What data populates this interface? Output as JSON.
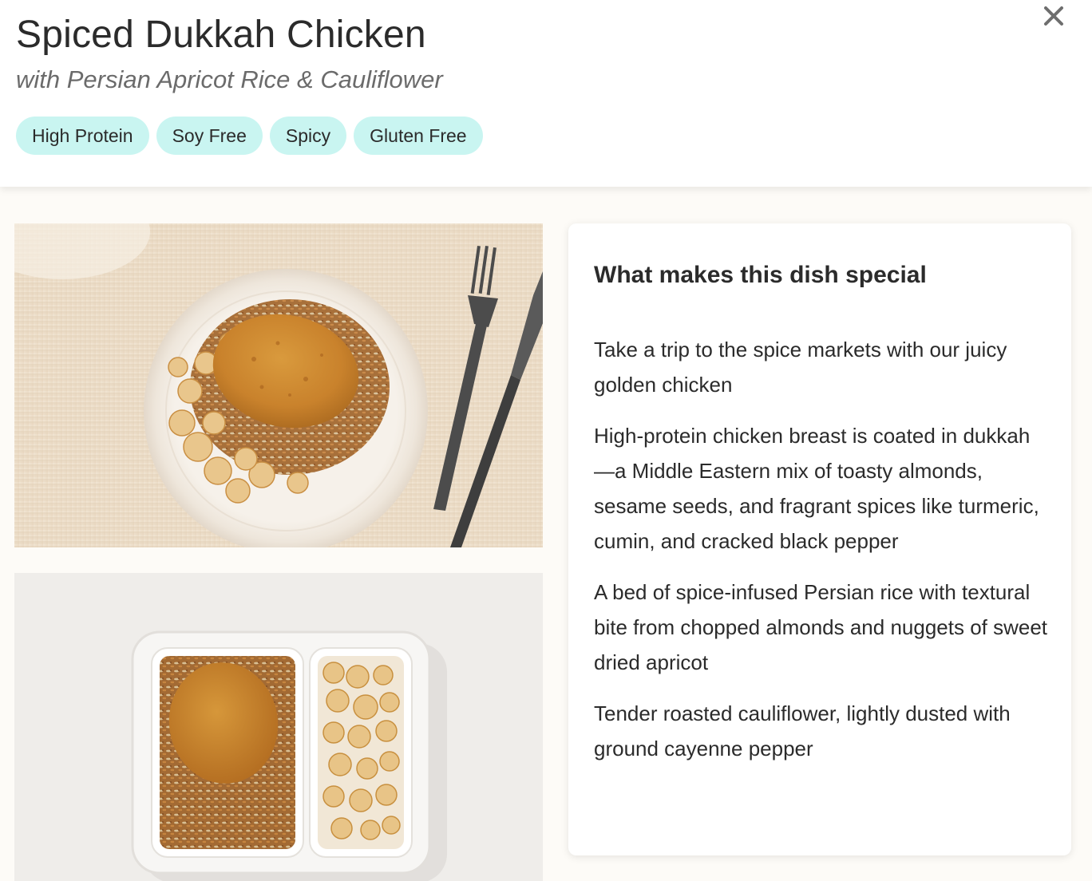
{
  "header": {
    "title": "Spiced Dukkah Chicken",
    "subtitle": "with Persian Apricot Rice & Cauliflower",
    "tags": [
      "High Protein",
      "Soy Free",
      "Spicy",
      "Gluten Free"
    ],
    "close_icon": "close-icon"
  },
  "images": {
    "plated_photo": "plated-dish-photo",
    "container_photo": "meal-container-photo"
  },
  "special": {
    "title": "What makes this dish special",
    "points": [
      "Take a trip to the spice markets with our juicy golden chicken",
      "High-protein chicken breast is coated in dukkah—a Middle Eastern mix of toasty almonds, sesame seeds, and fragrant spices like turmeric, cumin, and cracked black pepper",
      "A bed of spice-infused Persian rice with textural bite from chopped almonds and nuggets of sweet dried apricot",
      "Tender roasted cauliflower, lightly dusted with ground cayenne pepper"
    ]
  },
  "colors": {
    "tag_bg": "#c9f5f1",
    "page_bg": "#fdfbf7",
    "text": "#2b2b2b",
    "subtitle": "#6b6b6b"
  }
}
